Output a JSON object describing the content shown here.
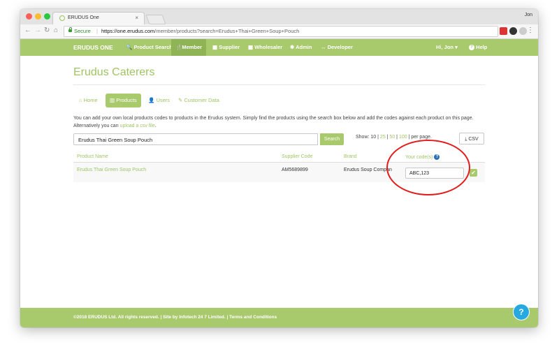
{
  "browser": {
    "tab_title": "ERUDUS One",
    "tab_close": "×",
    "user": "Jon",
    "secure_label": "Secure",
    "url_host": "https://one.erudus.com",
    "url_rest": "/member/products?search=Erudus+Thai+Green+Soup+Pouch"
  },
  "nav": {
    "brand": "ERUDUS ONE",
    "items": [
      {
        "icon": "🔍",
        "label": "Product Search"
      },
      {
        "icon": "🍴",
        "label": "Member"
      },
      {
        "icon": "▦",
        "label": "Supplier"
      },
      {
        "icon": "▦",
        "label": "Wholesaler"
      },
      {
        "icon": "✱",
        "label": "Admin"
      },
      {
        "icon": "↔",
        "label": "Developer"
      }
    ],
    "user": "Hi, Jon ▾",
    "help": "Help"
  },
  "page": {
    "heading": "Erudus Caterers",
    "tabs": [
      {
        "icon": "⌂",
        "label": "Home"
      },
      {
        "icon": "▥",
        "label": "Products"
      },
      {
        "icon": "👤",
        "label": "Users"
      },
      {
        "icon": "✎",
        "label": "Customer Data"
      }
    ],
    "description_1": "You can add your own local products codes to products in the Erudus system. Simply find the products using the search box below and add the codes against each product on this page.",
    "description_2": "Alternatively you can ",
    "description_link": "upload a csv file",
    "description_end": "."
  },
  "search": {
    "value": "Erudus Thai Green Soup Pouch",
    "button": "Search"
  },
  "show": {
    "prefix": "Show: ",
    "opt10": "10",
    "sep1": " | ",
    "opt25": "25",
    "sep2": " | ",
    "opt50": "50",
    "sep3": " | ",
    "opt100": "100",
    "suffix": " | per page."
  },
  "csv_button": "⤓ CSV",
  "table": {
    "headers": {
      "product_name": "Product Name",
      "supplier_code": "Supplier Code",
      "brand": "Brand",
      "your_codes": "Your code(s)"
    },
    "rows": [
      {
        "product_name": "Erudus Thai Green Soup Pouch",
        "supplier_code": "AM5689899",
        "brand": "Erudus Soup Compan",
        "your_codes": "ABC,123"
      }
    ]
  },
  "footer": {
    "text": "©2018 ERUDUS Ltd. All rights reserved. | Site by Infotech 24 7 Limited. | Terms and Conditions"
  },
  "help_fab": "?",
  "colors": {
    "brand_green": "#a8c96c",
    "link_green": "#a0c464",
    "annotation_red": "#e11c1c",
    "help_blue": "#26a8e0"
  }
}
